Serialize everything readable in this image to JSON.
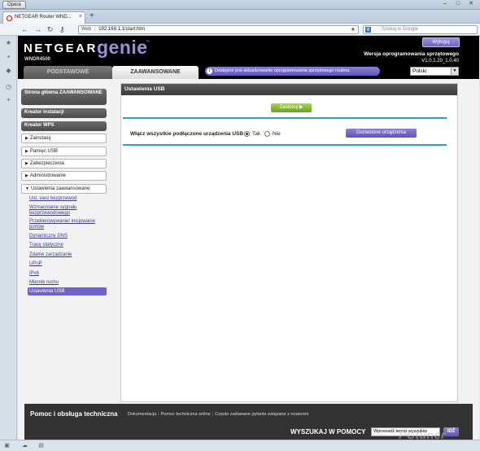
{
  "browser": {
    "menu_button": "Opera",
    "tab_title": "NETGEAR Router WND...",
    "url_site": "Web",
    "url": "192.168.1.1/start.htm",
    "search_placeholder": "Szukaj w Google",
    "search_engine_letter": "g"
  },
  "header": {
    "brand": "NETGEAR",
    "product": "genie",
    "trademark": "™",
    "model": "WNDR4500",
    "logout": "Wyloguj",
    "firmware_label": "Wersja oprogramowania sprzętowego",
    "firmware_version": "V1.0.1.20_1.0.40",
    "tab_basic": "PODSTAWOWE",
    "tab_advanced": "ZAAWANSOWANE",
    "fw_notice": "Dostępne jest aktualizowanie oprogramowania sprzętowego routera",
    "language": "Polski"
  },
  "menu": {
    "home": "Strona główna ZAAWANSOWANE",
    "setup_wizard": "Kreator instalacji",
    "wps_wizard": "Kreator WPS",
    "items": [
      {
        "label": "Zainstaluj"
      },
      {
        "label": "Pamięć USB"
      },
      {
        "label": "Zabezpieczenia"
      },
      {
        "label": "Administrowanie"
      },
      {
        "label": "Ustawienia zaawansowane"
      }
    ],
    "subitems": [
      "Ust. sieci bezprzewod",
      "Wzmacnianie sygnału bezprzewodowego",
      "Przekierowywanie/ inicjowanie portów",
      "Dynamiczny DNS",
      "Trasy statyczne",
      "Zdalne zarządzanie",
      "UPnP",
      "IPv6",
      "Miernik ruchu",
      "Ustawienia USB"
    ]
  },
  "content": {
    "title": "Ustawienia USB",
    "apply": "Zastosuj ▶",
    "enable_label": "Włącz wszystkie podłączone urządzenia USB",
    "option_yes": "Tak",
    "option_no": "Nie",
    "selected": "Tak",
    "devices_button": "Dozwolone urządzenia"
  },
  "footer": {
    "help_title": "Pomoc i obsługa techniczna",
    "link_docs": "Dokumentacja",
    "link_support": "Pomoc techniczna online",
    "link_faq": "Często zadawane pytania związane z routerem",
    "search_label": "WYSZUKAJ W POMOCY",
    "search_value": "Wprowadź temat wyszukiw",
    "go": "IDŹ"
  },
  "watermark": "PCtuner"
}
